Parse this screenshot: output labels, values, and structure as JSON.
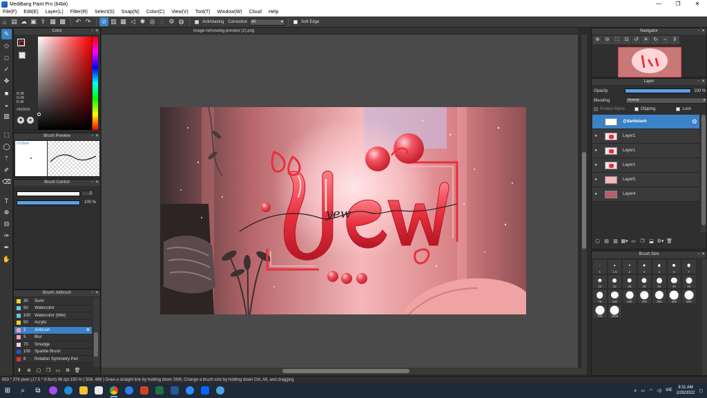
{
  "window": {
    "title": "MediBang Paint Pro (64bit)",
    "min": "—",
    "max": "❐",
    "close": "✕"
  },
  "menu": [
    "File(F)",
    "Edit(E)",
    "Layer(L)",
    "Filter(R)",
    "Select(S)",
    "Snap(N)",
    "Color(C)",
    "View(V)",
    "Tool(T)",
    "Window(W)",
    "Cloud",
    "Help"
  ],
  "toolbar": {
    "antialiasing": "AntiAliasing",
    "correction_label": "Correction",
    "correction_value": "40",
    "soft_edge": "Soft Edge"
  },
  "color_panel": {
    "title": "Color",
    "r": "R:38",
    "g": "G:38",
    "b": "B:38",
    "hex": "#262626",
    "fg": "#262626"
  },
  "brush_preview": {
    "title": "Brush Preview",
    "size": "0.53mm"
  },
  "brush_control": {
    "title": "Brush Control",
    "size_value": "2",
    "opacity_value": "100 %",
    "opacity_fill": 1.0
  },
  "brush_list": {
    "title": "Brush: Airbrush",
    "items": [
      {
        "size": "30",
        "name": "Sumi",
        "color": "#f5d130"
      },
      {
        "size": "50",
        "name": "Watercolor",
        "color": "#6cc3ea"
      },
      {
        "size": "100",
        "name": "Watercolor (Wet)",
        "color": "#6cc3ea"
      },
      {
        "size": "50",
        "name": "Acrylic",
        "color": "#f5d130"
      },
      {
        "size": "2",
        "name": "Airbrush",
        "color": "#f0a0c0",
        "selected": true
      },
      {
        "size": "5",
        "name": "Blur",
        "color": "#f0a0c0"
      },
      {
        "size": "70",
        "name": "Smudge",
        "color": "#f5d0e0"
      },
      {
        "size": "100",
        "name": "Sparkle Brush",
        "color": "#3050d0"
      },
      {
        "size": "8",
        "name": "Rotation Symmetry Pen",
        "color": "#e03030"
      }
    ]
  },
  "document": {
    "tab": "image-removebg-preview (2).png"
  },
  "navigator": {
    "title": "Navigator"
  },
  "layer_panel": {
    "title": "Layer",
    "opacity_label": "Opacity",
    "opacity_value": "100 %",
    "blending_label": "Blending",
    "blending_value": "Normal",
    "protect_alpha": "Protect Alpha",
    "clipping": "Clipping",
    "lock": "Lock",
    "layers": [
      {
        "name": "@danhdanh",
        "selected": true
      },
      {
        "name": "Layer1"
      },
      {
        "name": "Layer1"
      },
      {
        "name": "Layer1"
      },
      {
        "name": "Layer5"
      },
      {
        "name": "Layer4"
      }
    ]
  },
  "brush_size": {
    "title": "Brush Size",
    "sizes": [
      "1",
      "1.5",
      "2",
      "3",
      "4",
      "5",
      "7",
      "10",
      "15",
      "20",
      "25",
      "30",
      "40",
      "50",
      "70",
      "100",
      "150",
      "200",
      "300",
      "400",
      "500",
      "700",
      "1000"
    ]
  },
  "statusbar": {
    "text": "663 * 376 pixel   (17.5 * 9.9cm)   96 dpi   150 %   ( 508, 469 )   Draw a straight line by holding down Shift, Change a brush size by holding down Ctrl, Alt, and dragging"
  },
  "taskbar": {
    "time": "9:11 AM",
    "date": "2/20/2022",
    "lang": "VIE"
  },
  "artwork": {
    "word": "Yew",
    "signature": "yew"
  }
}
